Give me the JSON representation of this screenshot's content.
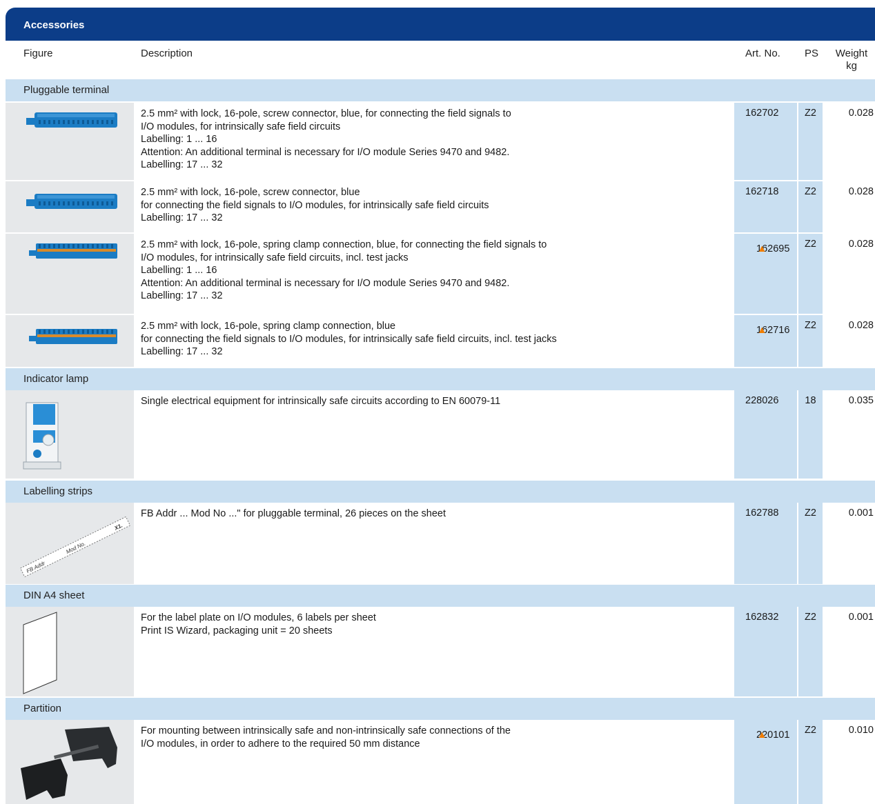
{
  "section_title": "Accessories",
  "headers": {
    "figure": "Figure",
    "description": "Description",
    "art_no": "Art. No.",
    "ps": "PS",
    "weight_line1": "Weight",
    "weight_line2": "kg"
  },
  "categories": {
    "pluggable_terminal": "Pluggable terminal",
    "indicator_lamp": "Indicator lamp",
    "labelling_strips": "Labelling strips",
    "din_a4_sheet": "DIN A4 sheet",
    "partition": "Partition"
  },
  "rows": [
    {
      "lines": [
        "2.5 mm² with lock, 16-pole, screw connector, blue, for connecting the field signals to",
        "I/O modules, for intrinsically safe field circuits",
        "Labelling: 1 ... 16",
        "Attention: An additional terminal is necessary for I/O module Series 9470 and 9482.",
        "Labelling: 17 ... 32"
      ],
      "art_no": "162702",
      "marker": "",
      "ps": "Z2",
      "weight": "0.028"
    },
    {
      "lines": [
        "2.5 mm² with lock, 16-pole, screw connector, blue",
        "for connecting the field signals to I/O modules, for intrinsically safe field circuits",
        "Labelling: 17 ... 32"
      ],
      "art_no": "162718",
      "marker": "",
      "ps": "Z2",
      "weight": "0.028"
    },
    {
      "lines": [
        "2.5 mm² with lock, 16-pole, spring clamp connection, blue, for connecting the field signals to",
        "I/O modules, for intrinsically safe field circuits, incl. test jacks",
        "Labelling: 1 ... 16",
        "Attention: An additional terminal is necessary for I/O module Series 9470 and 9482.",
        "Labelling: 17 ... 32"
      ],
      "art_no": "162695",
      "marker": "▲",
      "ps": "Z2",
      "weight": "0.028"
    },
    {
      "lines": [
        "2.5 mm² with lock, 16-pole, spring clamp connection, blue",
        "for connecting the field signals to I/O modules, for intrinsically safe field circuits, incl. test jacks",
        "Labelling: 17 ... 32"
      ],
      "art_no": "162716",
      "marker": "▲",
      "ps": "Z2",
      "weight": "0.028"
    },
    {
      "lines": [
        "Single electrical equipment for intrinsically safe circuits according to EN 60079-11"
      ],
      "art_no": "228026",
      "marker": "",
      "ps": "18",
      "weight": "0.035"
    },
    {
      "lines": [
        "FB Addr ... Mod No ...\" for pluggable terminal, 26 pieces on the sheet"
      ],
      "art_no": "162788",
      "marker": "",
      "ps": "Z2",
      "weight": "0.001"
    },
    {
      "lines": [
        "For the label plate on I/O modules, 6 labels per sheet",
        "Print IS Wizard, packaging unit = 20 sheets"
      ],
      "art_no": "162832",
      "marker": "",
      "ps": "Z2",
      "weight": "0.001"
    },
    {
      "lines": [
        "For mounting between intrinsically safe and non-intrinsically safe connections of the",
        "I/O modules, in order to adhere to the required 50 mm distance"
      ],
      "art_no": "220101",
      "marker": "▲",
      "ps": "Z2",
      "weight": "0.010"
    }
  ],
  "strip_labels": {
    "a": "FB Addr",
    "b": "Mod No.",
    "c": "X1."
  },
  "colors": {
    "title_bar": "#0c3d88",
    "category_band": "#c9dff1",
    "figure_cell": "#e6e8ea",
    "marker": "#f07d00",
    "terminal_blue": "#1b7cc4"
  },
  "icons": {
    "terminal": "screw-terminal-icon",
    "spring_terminal": "spring-terminal-icon",
    "lamp": "indicator-lamp-icon",
    "strip": "labelling-strip-icon",
    "sheet": "a4-sheet-icon",
    "partition": "partition-icon"
  }
}
